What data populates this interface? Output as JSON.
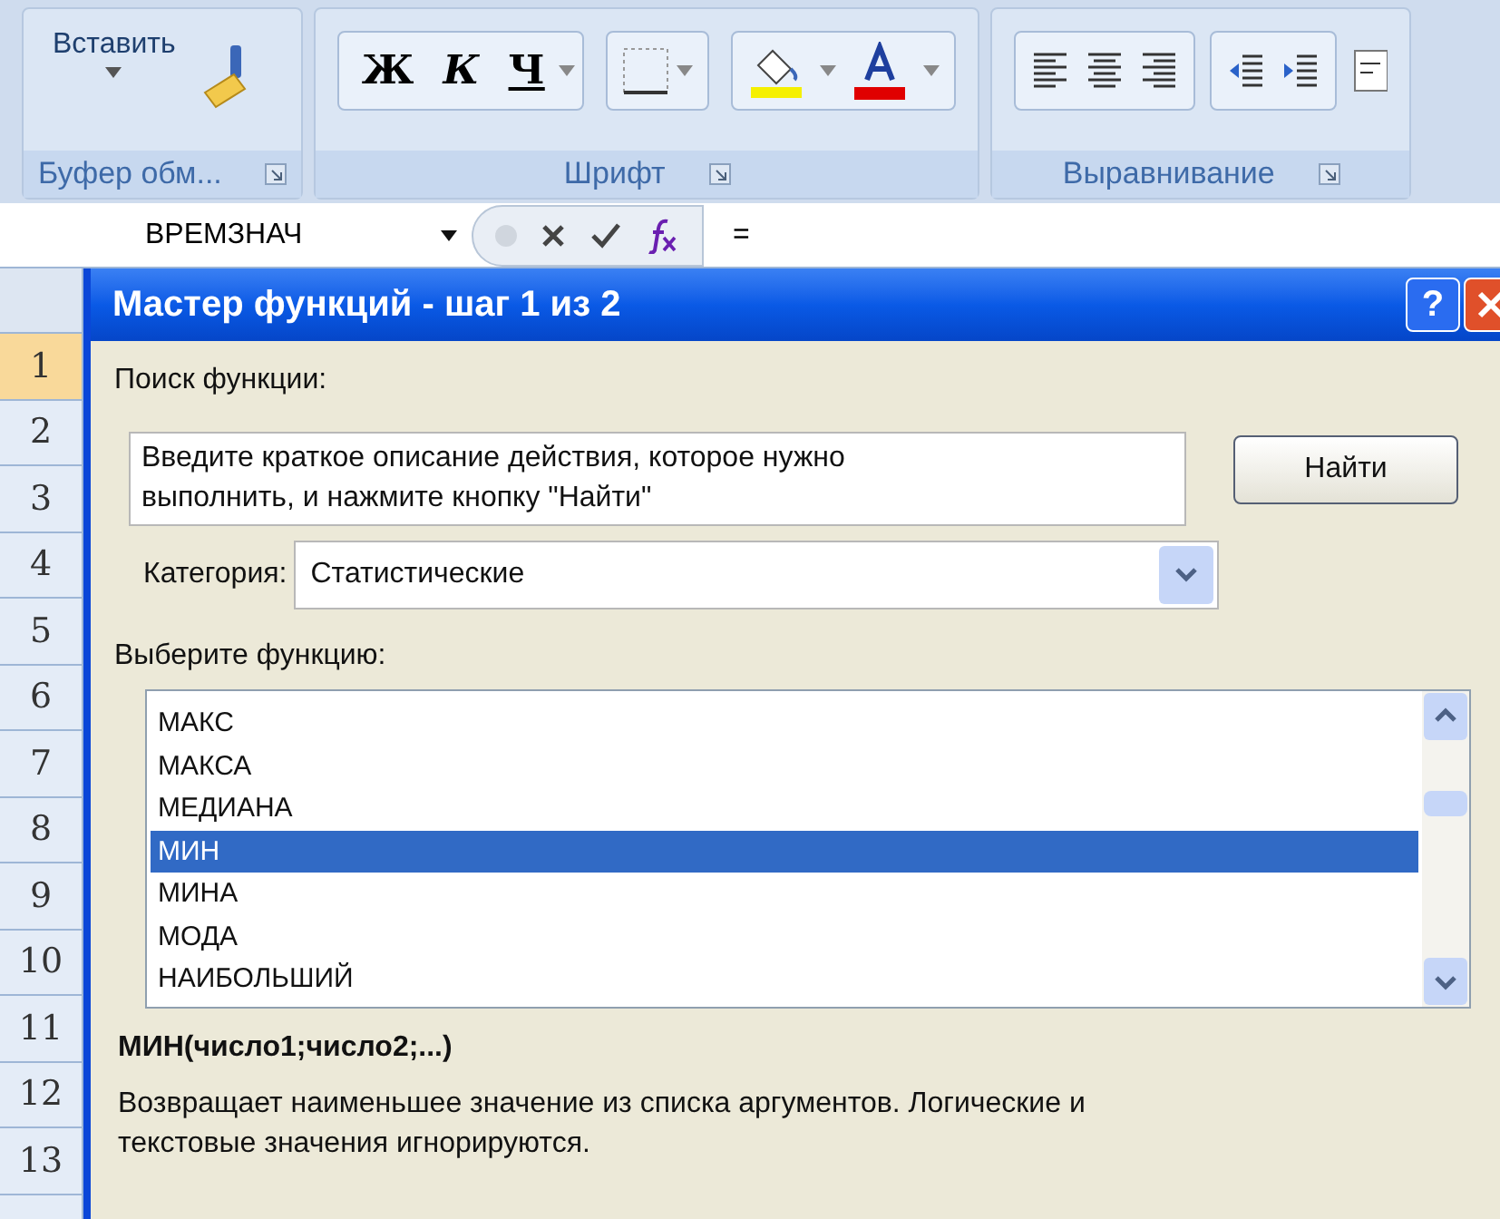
{
  "ribbon": {
    "groups": [
      {
        "kind": "clipboard",
        "label": "Буфер обм...",
        "paste": "Вставить"
      },
      {
        "kind": "font",
        "label": "Шрифт",
        "bold": "Ж",
        "italic": "К",
        "underline": "Ч"
      },
      {
        "kind": "alignment",
        "label": "Выравнивание"
      }
    ]
  },
  "formula_bar": {
    "name_box": "ВРЕМЗНАЧ",
    "formula": "="
  },
  "row_headers": [
    {
      "label": "1",
      "selected": true
    },
    {
      "label": "2",
      "selected": false
    },
    {
      "label": "3",
      "selected": false
    },
    {
      "label": "4",
      "selected": false
    },
    {
      "label": "5",
      "selected": false
    },
    {
      "label": "6",
      "selected": false
    },
    {
      "label": "7",
      "selected": false
    },
    {
      "label": "8",
      "selected": false
    },
    {
      "label": "9",
      "selected": false
    },
    {
      "label": "10",
      "selected": false
    },
    {
      "label": "11",
      "selected": false
    },
    {
      "label": "12",
      "selected": false
    },
    {
      "label": "13",
      "selected": false
    }
  ],
  "dialog": {
    "title": "Мастер функций - шаг 1 из 2",
    "help": "?",
    "search_label": "Поиск функции:",
    "search_placeholder": "Введите краткое описание действия, которое нужно выполнить, и нажмите кнопку \"Найти\"",
    "find_button": "Найти",
    "category_label": "Категория:",
    "category": "Статистические",
    "list_label": "Выберите функцию:",
    "functions": [
      {
        "name": "МАКС",
        "selected": false
      },
      {
        "name": "МАКСА",
        "selected": false
      },
      {
        "name": "МЕДИАНА",
        "selected": false
      },
      {
        "name": "МИН",
        "selected": true
      },
      {
        "name": "МИНА",
        "selected": false
      },
      {
        "name": "МОДА",
        "selected": false
      },
      {
        "name": "НАИБОЛЬШИЙ",
        "selected": false
      }
    ],
    "signature": "МИН(число1;число2;...)",
    "description": "Возвращает наименьшее значение из списка аргументов. Логические и текстовые значения игнорируются."
  }
}
